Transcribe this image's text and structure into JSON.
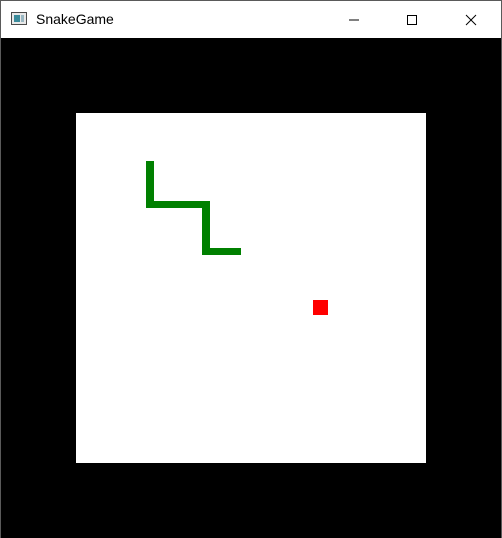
{
  "window": {
    "title": "SnakeGame",
    "icon": "app-window-icon",
    "controls": [
      "minimize-icon",
      "maximize-icon",
      "close-icon"
    ]
  },
  "game": {
    "background_color": "#000000",
    "board_color": "#ffffff",
    "snake_color": "#008000",
    "food_color": "#ff0000"
  }
}
